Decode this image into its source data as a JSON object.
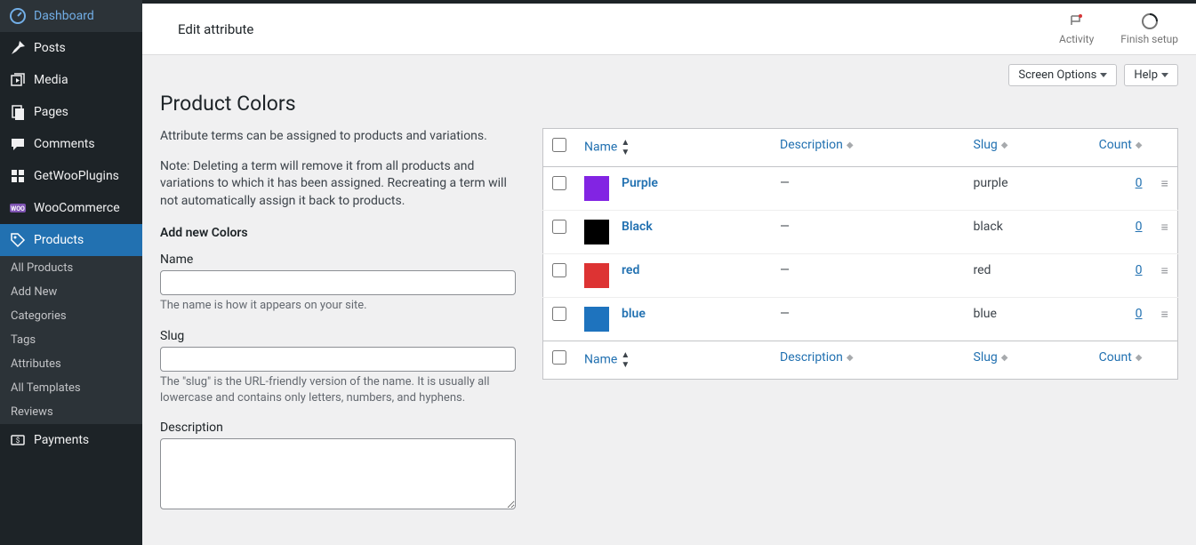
{
  "sidebar": {
    "items": [
      {
        "label": "Dashboard"
      },
      {
        "label": "Posts"
      },
      {
        "label": "Media"
      },
      {
        "label": "Pages"
      },
      {
        "label": "Comments"
      },
      {
        "label": "GetWooPlugins"
      },
      {
        "label": "WooCommerce"
      },
      {
        "label": "Products"
      },
      {
        "label": "Payments"
      }
    ],
    "sub_products": [
      {
        "label": "All Products"
      },
      {
        "label": "Add New"
      },
      {
        "label": "Categories"
      },
      {
        "label": "Tags"
      },
      {
        "label": "Attributes"
      },
      {
        "label": "All Templates"
      },
      {
        "label": "Reviews"
      }
    ]
  },
  "header": {
    "title": "Edit attribute",
    "activity": "Activity",
    "finish_setup": "Finish setup"
  },
  "buttons": {
    "screen_options": "Screen Options",
    "help": "Help"
  },
  "page": {
    "heading": "Product Colors",
    "intro": "Attribute terms can be assigned to products and variations.",
    "note": "Note: Deleting a term will remove it from all products and variations to which it has been assigned. Recreating a term will not automatically assign it back to products.",
    "add_heading": "Add new Colors"
  },
  "form": {
    "name_label": "Name",
    "name_help": "The name is how it appears on your site.",
    "slug_label": "Slug",
    "slug_help": "The \"slug\" is the URL-friendly version of the name. It is usually all lowercase and contains only letters, numbers, and hyphens.",
    "desc_label": "Description"
  },
  "table": {
    "cols": {
      "name": "Name",
      "description": "Description",
      "slug": "Slug",
      "count": "Count"
    },
    "rows": [
      {
        "name": "Purple",
        "color": "#8224e3",
        "desc": "—",
        "slug": "purple",
        "count": "0"
      },
      {
        "name": "Black",
        "color": "#000000",
        "desc": "—",
        "slug": "black",
        "count": "0"
      },
      {
        "name": "red",
        "color": "#dd3333",
        "desc": "—",
        "slug": "red",
        "count": "0"
      },
      {
        "name": "blue",
        "color": "#1e73be",
        "desc": "—",
        "slug": "blue",
        "count": "0"
      }
    ]
  }
}
